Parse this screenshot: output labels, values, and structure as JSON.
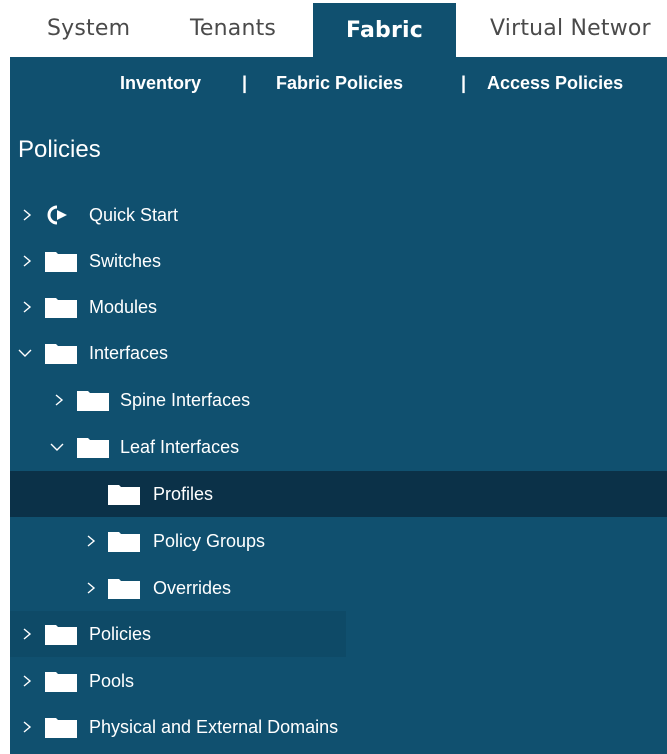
{
  "top_tabs": [
    {
      "label": "System"
    },
    {
      "label": "Tenants"
    },
    {
      "label": "Fabric"
    },
    {
      "label": "Virtual Networ"
    }
  ],
  "subnav": {
    "inventory": "Inventory",
    "sep": "|",
    "fabric_policies": "Fabric Policies",
    "access_policies": "Access Policies"
  },
  "panel": {
    "title": "Policies"
  },
  "tree": [
    {
      "label": "Quick Start",
      "icon": "quick-start-icon",
      "state": "collapsed"
    },
    {
      "label": "Switches",
      "icon": "folder-icon",
      "state": "collapsed"
    },
    {
      "label": "Modules",
      "icon": "folder-icon",
      "state": "collapsed"
    },
    {
      "label": "Interfaces",
      "icon": "folder-icon",
      "state": "expanded"
    },
    {
      "label": "Spine Interfaces",
      "icon": "folder-icon",
      "state": "collapsed"
    },
    {
      "label": "Leaf Interfaces",
      "icon": "folder-icon",
      "state": "expanded"
    },
    {
      "label": "Profiles",
      "icon": "folder-icon",
      "state": "leaf",
      "selected": true
    },
    {
      "label": "Policy Groups",
      "icon": "folder-icon",
      "state": "collapsed"
    },
    {
      "label": "Overrides",
      "icon": "folder-icon",
      "state": "collapsed"
    },
    {
      "label": "Policies",
      "icon": "folder-icon",
      "state": "collapsed"
    },
    {
      "label": "Pools",
      "icon": "folder-icon",
      "state": "collapsed"
    },
    {
      "label": "Physical and External Domains",
      "icon": "folder-icon",
      "state": "collapsed"
    }
  ],
  "colors": {
    "panel_bg": "#10506f",
    "selected_bg": "#0b3148",
    "tab_text": "#4a4a4a",
    "white": "#ffffff"
  }
}
